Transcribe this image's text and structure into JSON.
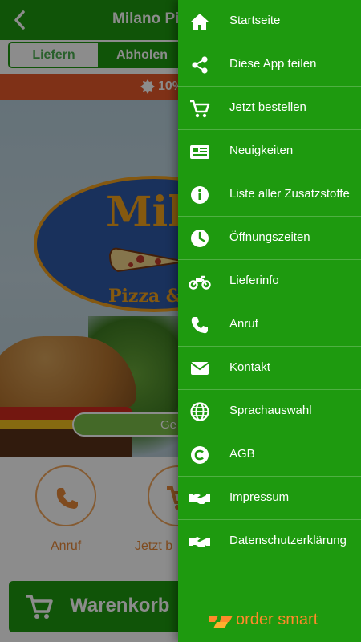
{
  "header": {
    "title": "Milano Piz"
  },
  "order_mode": {
    "tabs": [
      "Liefern",
      "Abholen"
    ],
    "selected": "Abholen"
  },
  "promo": {
    "text": "10%"
  },
  "hero": {
    "logo_text": "Mil",
    "logo_subtext": "Pizza &",
    "status_pill": "Ge"
  },
  "actions": [
    {
      "label": "Anruf",
      "icon": "phone-icon"
    },
    {
      "label": "Jetzt b",
      "icon": "cart-icon"
    }
  ],
  "cart": {
    "label": "Warenkorb"
  },
  "drawer": {
    "items": [
      {
        "label": "Startseite",
        "icon": "home-icon"
      },
      {
        "label": "Diese App teilen",
        "icon": "share-icon"
      },
      {
        "label": "Jetzt bestellen",
        "icon": "cart-icon"
      },
      {
        "label": "Neuigkeiten",
        "icon": "news-icon"
      },
      {
        "label": "Liste aller Zusatzstoffe",
        "icon": "info-icon"
      },
      {
        "label": "Öffnungszeiten",
        "icon": "clock-icon"
      },
      {
        "label": "Lieferinfo",
        "icon": "motorcycle-icon"
      },
      {
        "label": "Anruf",
        "icon": "phone-icon"
      },
      {
        "label": "Kontakt",
        "icon": "mail-icon"
      },
      {
        "label": "Sprachauswahl",
        "icon": "globe-icon"
      },
      {
        "label": "AGB",
        "icon": "copyright-icon"
      },
      {
        "label": "Impressum",
        "icon": "handshake-icon"
      },
      {
        "label": "Datenschutzerklärung",
        "icon": "handshake-icon"
      }
    ],
    "brand": "order smart"
  },
  "colors": {
    "primary_green": "#1e9a0f",
    "accent_orange": "#e8893a",
    "promo_red": "#e85a2a"
  }
}
